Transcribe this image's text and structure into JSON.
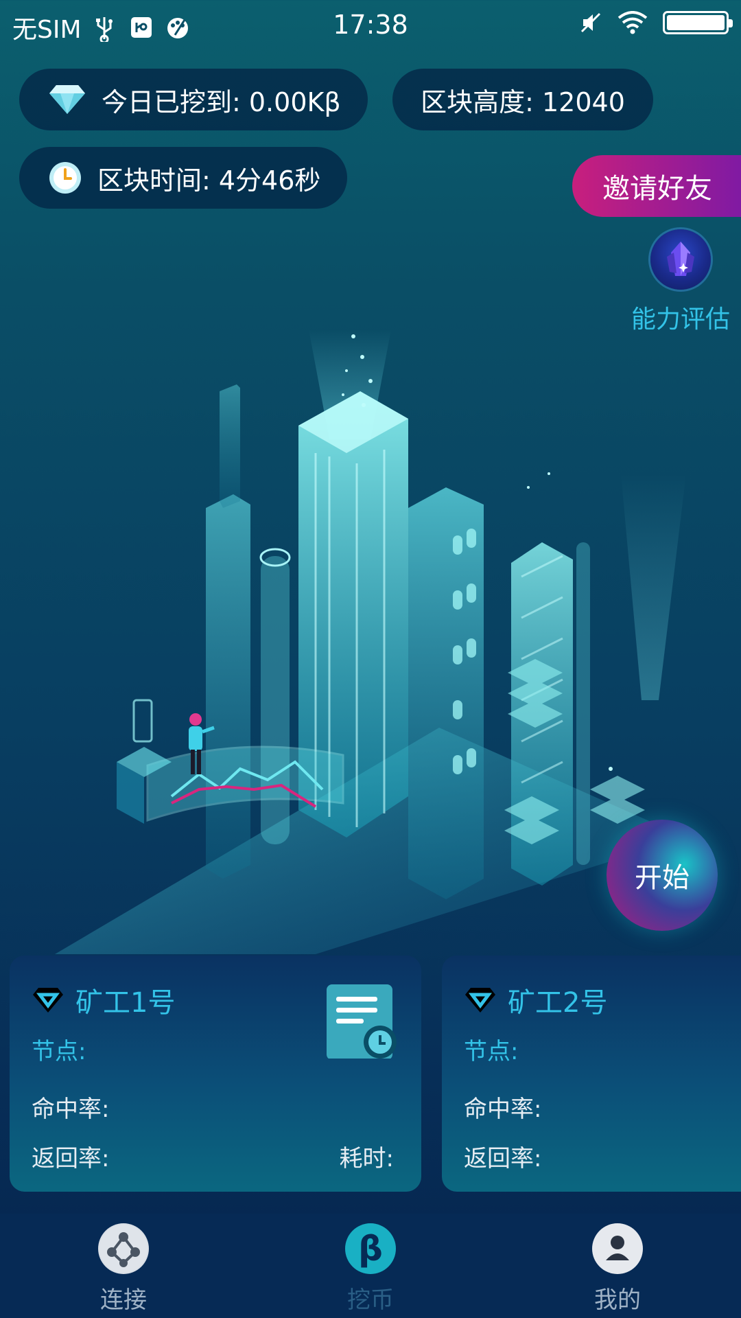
{
  "status_bar": {
    "carrier": "无SIM",
    "time": "17:38"
  },
  "stats": {
    "mined_today": "今日已挖到: 0.00Kβ",
    "block_height": "区块高度: 12040",
    "block_time": "区块时间: 4分46秒"
  },
  "invite": {
    "label": "邀请好友"
  },
  "ability": {
    "label": "能力评估"
  },
  "start": {
    "label": "开始"
  },
  "miners": [
    {
      "title": "矿工1号",
      "node_label": "节点:",
      "hit_label": "命中率:",
      "return_label": "返回率:",
      "elapsed_label": "耗时:"
    },
    {
      "title": "矿工2号",
      "node_label": "节点:",
      "hit_label": "命中率:",
      "return_label": "返回率:"
    }
  ],
  "nav": {
    "items": [
      {
        "label": "连接",
        "icon": "network-ball-icon"
      },
      {
        "label": "挖币",
        "icon": "beta-coin-icon"
      },
      {
        "label": "我的",
        "icon": "user-icon"
      }
    ]
  },
  "colors": {
    "accent_cyan": "#33c3e8",
    "invite_gradient_start": "#c81f7d",
    "invite_gradient_end": "#7c1aa5",
    "card_bg": "#0a3262"
  }
}
